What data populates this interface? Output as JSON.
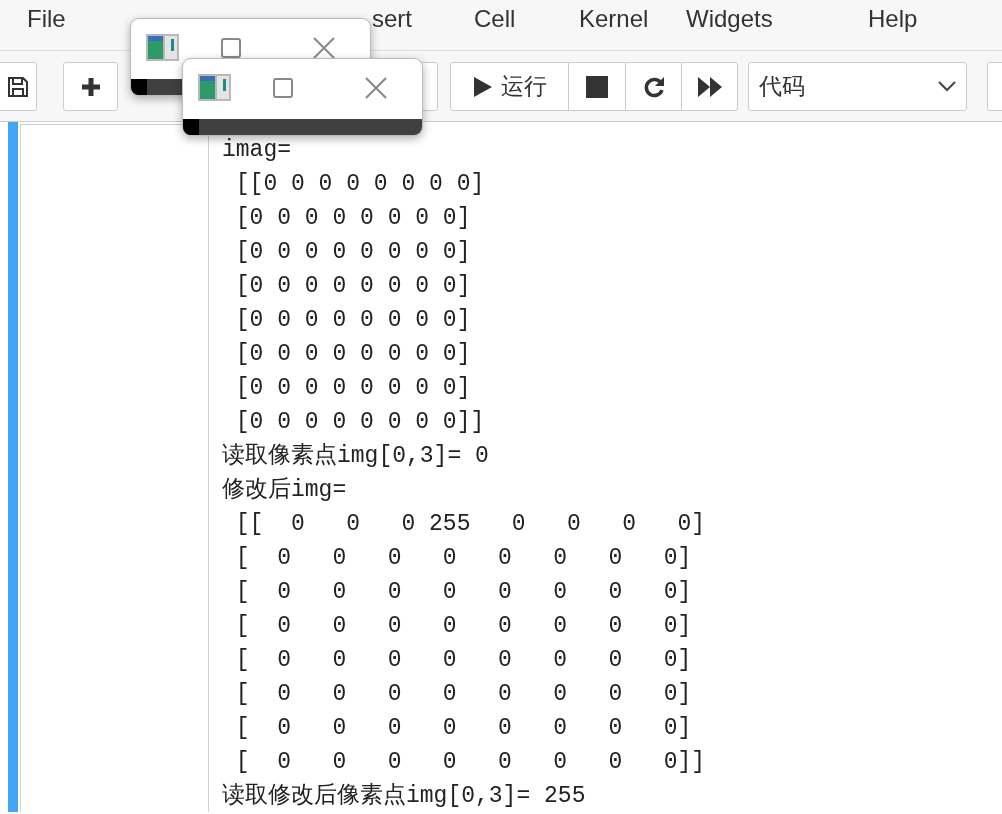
{
  "menu": [
    "File",
    "sert",
    "Cell",
    "Kernel",
    "Widgets",
    "Help"
  ],
  "toolbar": {
    "run_label": "运行",
    "cell_type": "代码"
  },
  "output_lines": [
    "imag=",
    " [[0 0 0 0 0 0 0 0]",
    " [0 0 0 0 0 0 0 0]",
    " [0 0 0 0 0 0 0 0]",
    " [0 0 0 0 0 0 0 0]",
    " [0 0 0 0 0 0 0 0]",
    " [0 0 0 0 0 0 0 0]",
    " [0 0 0 0 0 0 0 0]",
    " [0 0 0 0 0 0 0 0]]",
    "读取像素点img[0,3]= 0",
    "修改后img=",
    " [[  0   0   0 255   0   0   0   0]",
    " [  0   0   0   0   0   0   0   0]",
    " [  0   0   0   0   0   0   0   0]",
    " [  0   0   0   0   0   0   0   0]",
    " [  0   0   0   0   0   0   0   0]",
    " [  0   0   0   0   0   0   0   0]",
    " [  0   0   0   0   0   0   0   0]",
    " [  0   0   0   0   0   0   0   0]]",
    "读取修改后像素点img[0,3]= 255"
  ]
}
